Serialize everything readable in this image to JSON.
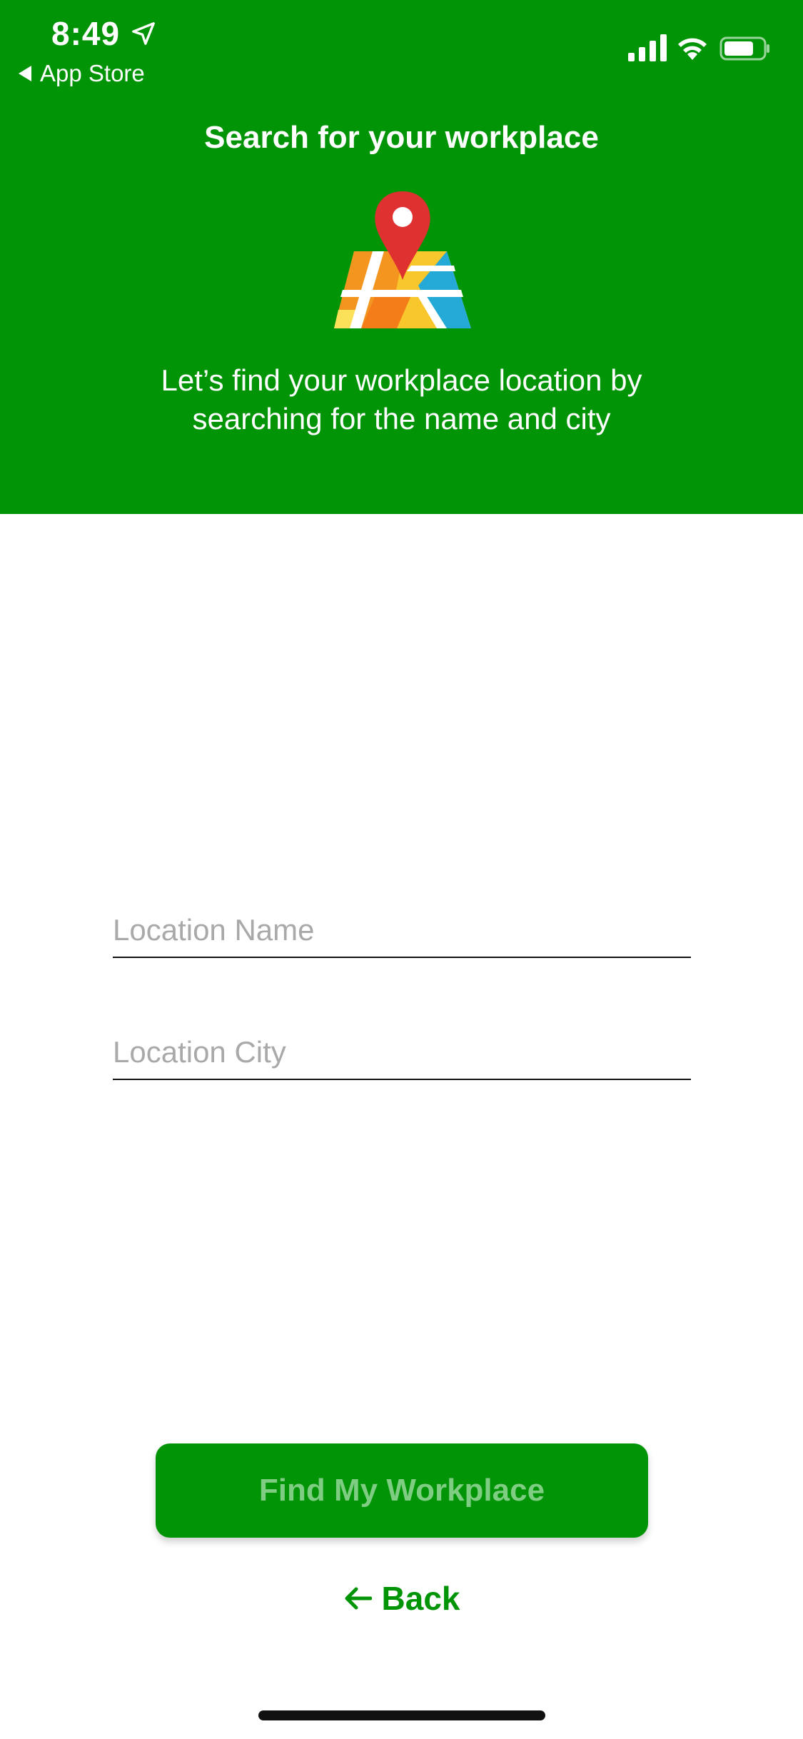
{
  "status_bar": {
    "time": "8:49",
    "back_app_label": "App Store"
  },
  "header": {
    "title": "Search for your workplace",
    "subtitle": "Let’s find your workplace location by searching for the name and city",
    "background_color": "#009406"
  },
  "form": {
    "location_name_placeholder": "Location Name",
    "location_name_value": "",
    "location_city_placeholder": "Location City",
    "location_city_value": ""
  },
  "actions": {
    "find_label": "Find My Workplace",
    "back_label": "Back"
  },
  "icons": {
    "status": [
      "location-arrow-icon",
      "signal-icon",
      "wifi-icon",
      "battery-icon"
    ],
    "hero": "map-pin-icon",
    "back": "arrow-left-icon"
  },
  "colors": {
    "brand_green": "#009406",
    "disabled_button_text": "#7fcd83",
    "placeholder": "#a9a9a9"
  }
}
